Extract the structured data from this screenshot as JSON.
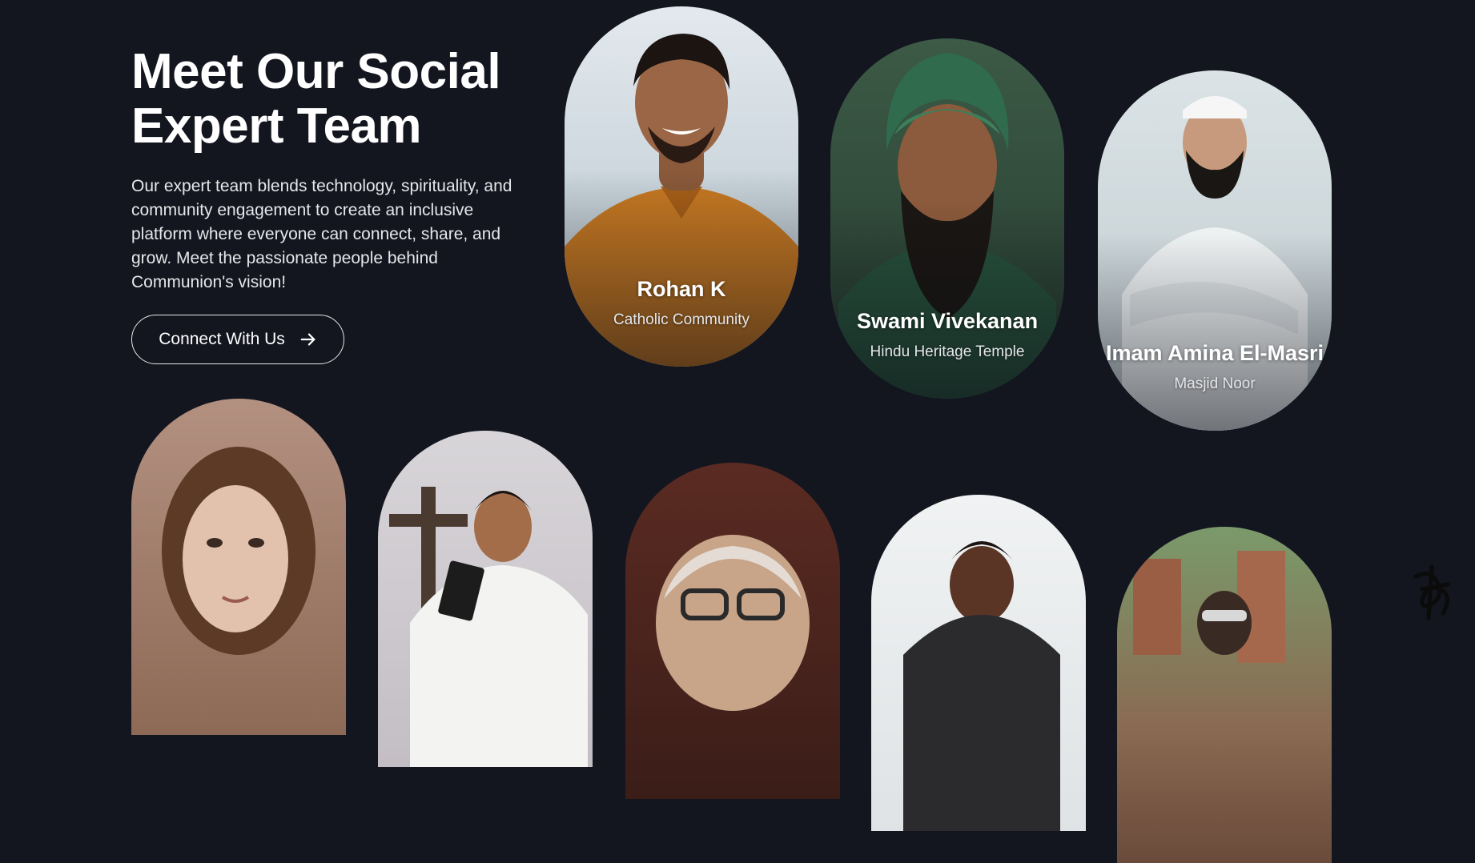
{
  "intro": {
    "heading": "Meet Our Social Expert Team",
    "description": "Our expert team blends technology, spirituality, and community engagement to create an inclusive platform where everyone can connect, share, and grow. Meet the passionate people behind Communion's vision!",
    "cta_label": "Connect With Us",
    "cta_icon": "arrow-right-icon"
  },
  "team": [
    {
      "name": "Rohan K",
      "organization": "Catholic Community"
    },
    {
      "name": "Swami Vivekanan",
      "organization": "Hindu Heritage Temple"
    },
    {
      "name": "Imam Amina El-Masri",
      "organization": "Masjid Noor"
    }
  ],
  "colors": {
    "background": "#13151f",
    "text": "#ffffff",
    "button_border": "#e8e8ea"
  }
}
